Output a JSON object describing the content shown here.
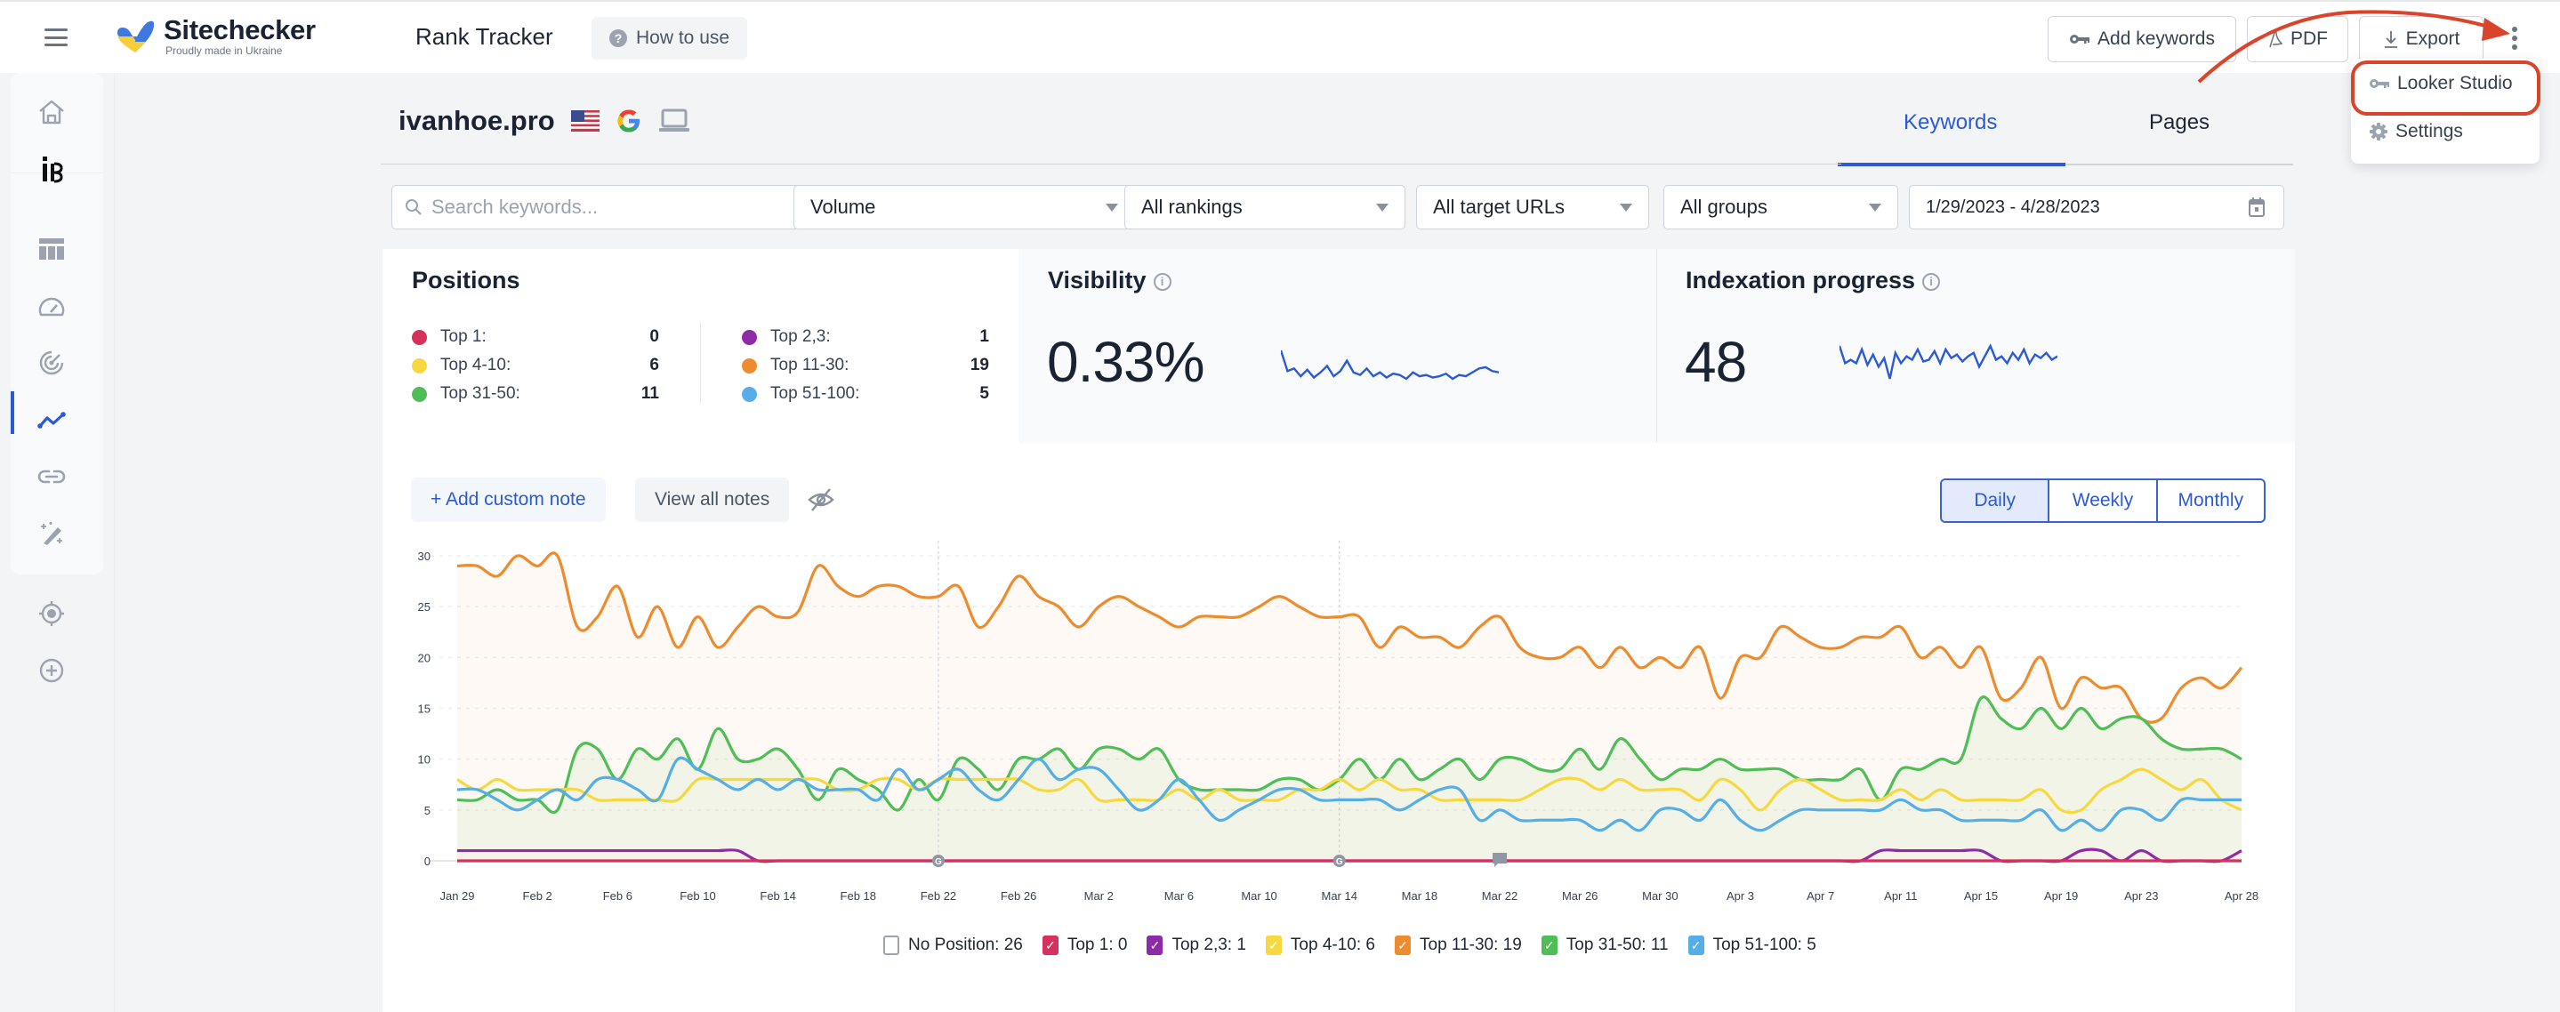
{
  "header": {
    "logo_name": "Sitechecker",
    "logo_tagline": "Proudly made in Ukraine",
    "app_title": "Rank Tracker",
    "how_to_use": "How to use",
    "add_keywords": "Add keywords",
    "pdf": "PDF",
    "export": "Export"
  },
  "menu": {
    "items": [
      {
        "label": "Looker Studio",
        "icon": "key-icon",
        "highlighted": true
      },
      {
        "label": "Settings",
        "icon": "gear-icon",
        "highlighted": false
      }
    ]
  },
  "annotation": {
    "color": "#d9442a"
  },
  "sidebar": {
    "items": [
      {
        "icon": "home-icon"
      },
      {
        "icon": "brand-ib-icon"
      },
      {
        "icon": "table-icon"
      },
      {
        "icon": "speedometer-icon"
      },
      {
        "icon": "radar-icon"
      },
      {
        "icon": "trend-line-icon",
        "active": true
      },
      {
        "icon": "link-icon"
      },
      {
        "icon": "magic-wand-icon"
      },
      {
        "icon": "target-icon"
      },
      {
        "icon": "plus-circle-icon"
      }
    ]
  },
  "project": {
    "domain": "ivanhoe.pro",
    "country_icon": "us-flag-icon",
    "engine_icon": "google-icon",
    "device_icon": "laptop-icon"
  },
  "tabs": [
    {
      "label": "Keywords",
      "active": true
    },
    {
      "label": "Pages",
      "active": false
    }
  ],
  "filters": {
    "search_placeholder": "Search keywords...",
    "sort": "Volume",
    "rankings": "All rankings",
    "target_urls": "All target URLs",
    "groups": "All groups",
    "date_range": "1/29/2023 - 4/28/2023"
  },
  "positions": {
    "title": "Positions",
    "left": [
      {
        "label": "Top 1:",
        "value": "0",
        "color": "#d6315d"
      },
      {
        "label": "Top 4-10:",
        "value": "6",
        "color": "#f7d93f"
      },
      {
        "label": "Top 31-50:",
        "value": "11",
        "color": "#4fbe57"
      }
    ],
    "right": [
      {
        "label": "Top 2,3:",
        "value": "1",
        "color": "#8e2ca8"
      },
      {
        "label": "Top 11-30:",
        "value": "19",
        "color": "#ec8c2e"
      },
      {
        "label": "Top 51-100:",
        "value": "5",
        "color": "#55aee8"
      }
    ]
  },
  "visibility": {
    "title": "Visibility",
    "value": "0.33%",
    "sparkline": [
      0.5,
      0.34,
      0.36,
      0.3,
      0.35,
      0.29,
      0.33,
      0.38,
      0.3,
      0.34,
      0.42,
      0.33,
      0.31,
      0.36,
      0.3,
      0.33,
      0.29,
      0.32,
      0.31,
      0.28,
      0.33,
      0.3,
      0.31,
      0.29,
      0.3,
      0.32,
      0.28,
      0.31,
      0.3,
      0.33,
      0.36,
      0.37,
      0.34,
      0.33
    ]
  },
  "indexation": {
    "title": "Indexation progress",
    "value": "48",
    "sparkline": [
      52,
      42,
      44,
      42,
      50,
      41,
      47,
      40,
      45,
      33,
      48,
      42,
      46,
      44,
      50,
      43,
      44,
      49,
      42,
      50,
      45,
      47,
      43,
      46,
      48,
      40,
      46,
      52,
      44,
      46,
      42,
      48,
      44,
      50,
      42,
      47,
      45,
      48,
      44,
      46
    ]
  },
  "chart_toolbar": {
    "add_note": "+ Add custom note",
    "view_notes": "View all notes",
    "periods": [
      {
        "label": "Daily",
        "active": true
      },
      {
        "label": "Weekly",
        "active": false
      },
      {
        "label": "Monthly",
        "active": false
      }
    ]
  },
  "chart_data": {
    "type": "line",
    "title": "",
    "xlabel": "",
    "ylabel": "",
    "ylim": [
      0,
      30
    ],
    "yticks": [
      0,
      5,
      10,
      15,
      20,
      25,
      30
    ],
    "grid": true,
    "start_date": "Jan 29",
    "end_date": "Apr 28",
    "xtick_labels": [
      "Jan 29",
      "Feb 2",
      "Feb 6",
      "Feb 10",
      "Feb 14",
      "Feb 18",
      "Feb 22",
      "Feb 26",
      "Mar 2",
      "Mar 6",
      "Mar 10",
      "Mar 14",
      "Mar 18",
      "Mar 22",
      "Mar 26",
      "Mar 30",
      "Apr 3",
      "Apr 7",
      "Apr 11",
      "Apr 15",
      "Apr 19",
      "Apr 23",
      "Apr 28"
    ],
    "xtick_day_index": [
      0,
      4,
      8,
      12,
      16,
      20,
      24,
      28,
      32,
      36,
      40,
      44,
      48,
      52,
      56,
      60,
      64,
      68,
      72,
      76,
      80,
      84,
      89
    ],
    "markers": [
      {
        "day_index": 24,
        "type": "google-update"
      },
      {
        "day_index": 44,
        "type": "google-update"
      },
      {
        "day_index": 52,
        "type": "note"
      }
    ],
    "legend_position": "bottom",
    "legend": [
      {
        "label": "No Position: 26",
        "checked": false,
        "color": "#9ca3af"
      },
      {
        "label": "Top 1: 0",
        "checked": true,
        "color": "#d6315d"
      },
      {
        "label": "Top 2,3: 1",
        "checked": true,
        "color": "#8e2ca8"
      },
      {
        "label": "Top 4-10: 6",
        "checked": true,
        "color": "#f7d93f"
      },
      {
        "label": "Top 11-30: 19",
        "checked": true,
        "color": "#ec8c2e"
      },
      {
        "label": "Top 31-50: 11",
        "checked": true,
        "color": "#4fbe57"
      },
      {
        "label": "Top 51-100: 5",
        "checked": true,
        "color": "#55aee8"
      }
    ],
    "series": [
      {
        "name": "Top 11-30",
        "color": "#ec8c2e",
        "fill": true,
        "values": [
          29,
          29,
          28,
          30,
          29,
          30,
          23,
          24,
          27,
          22,
          25,
          21,
          24,
          21,
          23,
          25,
          24,
          24.5,
          29,
          27,
          26,
          27,
          27,
          26,
          26,
          27,
          23,
          25,
          28,
          26,
          25,
          23,
          25,
          26,
          25,
          24,
          23,
          24,
          24,
          24,
          25,
          26,
          25,
          24,
          24,
          24,
          21,
          23,
          22,
          22,
          21,
          23,
          24,
          21,
          20,
          20,
          21,
          19,
          21,
          19,
          20,
          19,
          21,
          16,
          20,
          20,
          23,
          22,
          21,
          21,
          22,
          22,
          23,
          20,
          21,
          19,
          21,
          16,
          17,
          20,
          15,
          18,
          17,
          17,
          14,
          14,
          17,
          18,
          17,
          19
        ]
      },
      {
        "name": "Top 31-50",
        "color": "#4fbe57",
        "fill": true,
        "values": [
          6,
          6,
          7,
          6,
          6,
          5,
          11,
          11,
          8,
          11,
          10,
          12,
          9,
          13,
          10,
          10,
          11,
          9,
          6,
          9,
          8,
          7,
          5,
          8,
          6,
          10,
          9,
          7,
          10,
          10,
          11,
          9,
          11,
          11,
          10,
          11,
          8,
          7,
          7,
          7,
          7,
          8,
          8,
          7,
          8,
          10,
          8,
          10,
          8,
          9,
          10,
          8,
          10,
          10,
          9,
          9,
          11,
          9,
          12,
          10,
          8,
          9,
          9,
          10,
          9,
          9,
          9,
          8,
          8,
          8,
          9,
          6,
          9,
          9,
          10,
          10,
          16,
          14,
          13,
          15,
          13,
          15,
          13,
          14,
          14,
          12,
          11,
          11,
          11,
          10
        ]
      },
      {
        "name": "Top 4-10",
        "color": "#f7d93f",
        "fill": false,
        "values": [
          8,
          7,
          8,
          7,
          7,
          7,
          7,
          6,
          6,
          6,
          6,
          6,
          8,
          8,
          8,
          8,
          8,
          8,
          8,
          7,
          7,
          8,
          8,
          7,
          8,
          8,
          8,
          8,
          8,
          7,
          7,
          8,
          6,
          6,
          6,
          6,
          7,
          6,
          7,
          6,
          6,
          6,
          7,
          7,
          8,
          7,
          8,
          7,
          7,
          6,
          6,
          6,
          6,
          6,
          7,
          8,
          8,
          7,
          8,
          7,
          7,
          7,
          6,
          8,
          7,
          5,
          7,
          8,
          7,
          6,
          6,
          6,
          7,
          6,
          7,
          6,
          6,
          6,
          6,
          7,
          5,
          5,
          7,
          8,
          9,
          8,
          7,
          8,
          6,
          5
        ]
      },
      {
        "name": "Top 51-100",
        "color": "#55aee8",
        "fill": false,
        "values": [
          7,
          7,
          6,
          5,
          6,
          7,
          6,
          8,
          8,
          7,
          6,
          10,
          9,
          8,
          7,
          8,
          7,
          8,
          7,
          7,
          7,
          6,
          9,
          7,
          8,
          9,
          7,
          6,
          8,
          10,
          8,
          9,
          9,
          7,
          5,
          6,
          8,
          6,
          4,
          5,
          6,
          7,
          7,
          6,
          6,
          6,
          6,
          5,
          6,
          7,
          7,
          4,
          5,
          4,
          4,
          4,
          4,
          3,
          4,
          3,
          5,
          5,
          4,
          6,
          4,
          3,
          4,
          5,
          5,
          5,
          5,
          5,
          6,
          5,
          5,
          4,
          4,
          4,
          4,
          5,
          3,
          4,
          3,
          5,
          5,
          4,
          6,
          6,
          6,
          6
        ]
      },
      {
        "name": "Top 2,3",
        "color": "#8e2ca8",
        "fill": false,
        "values": [
          1,
          1,
          1,
          1,
          1,
          1,
          1,
          1,
          1,
          1,
          1,
          1,
          1,
          1,
          1,
          0,
          0,
          0,
          0,
          0,
          0,
          0,
          0,
          0,
          0,
          0,
          0,
          0,
          0,
          0,
          0,
          0,
          0,
          0,
          0,
          0,
          0,
          0,
          0,
          0,
          0,
          0,
          0,
          0,
          0,
          0,
          0,
          0,
          0,
          0,
          0,
          0,
          0,
          0,
          0,
          0,
          0,
          0,
          0,
          0,
          0,
          0,
          0,
          0,
          0,
          0,
          0,
          0,
          0,
          0,
          0,
          1,
          1,
          1,
          1,
          1,
          1,
          0,
          0,
          0,
          0,
          1,
          1,
          0,
          1,
          0,
          0,
          0,
          0,
          1
        ]
      },
      {
        "name": "Top 1",
        "color": "#d6315d",
        "fill": false,
        "values": [
          0,
          0,
          0,
          0,
          0,
          0,
          0,
          0,
          0,
          0,
          0,
          0,
          0,
          0,
          0,
          0,
          0,
          0,
          0,
          0,
          0,
          0,
          0,
          0,
          0,
          0,
          0,
          0,
          0,
          0,
          0,
          0,
          0,
          0,
          0,
          0,
          0,
          0,
          0,
          0,
          0,
          0,
          0,
          0,
          0,
          0,
          0,
          0,
          0,
          0,
          0,
          0,
          0,
          0,
          0,
          0,
          0,
          0,
          0,
          0,
          0,
          0,
          0,
          0,
          0,
          0,
          0,
          0,
          0,
          0,
          0,
          0,
          0,
          0,
          0,
          0,
          0,
          0,
          0,
          0,
          0,
          0,
          0,
          0,
          0,
          0,
          0,
          0,
          0,
          0
        ]
      }
    ]
  }
}
